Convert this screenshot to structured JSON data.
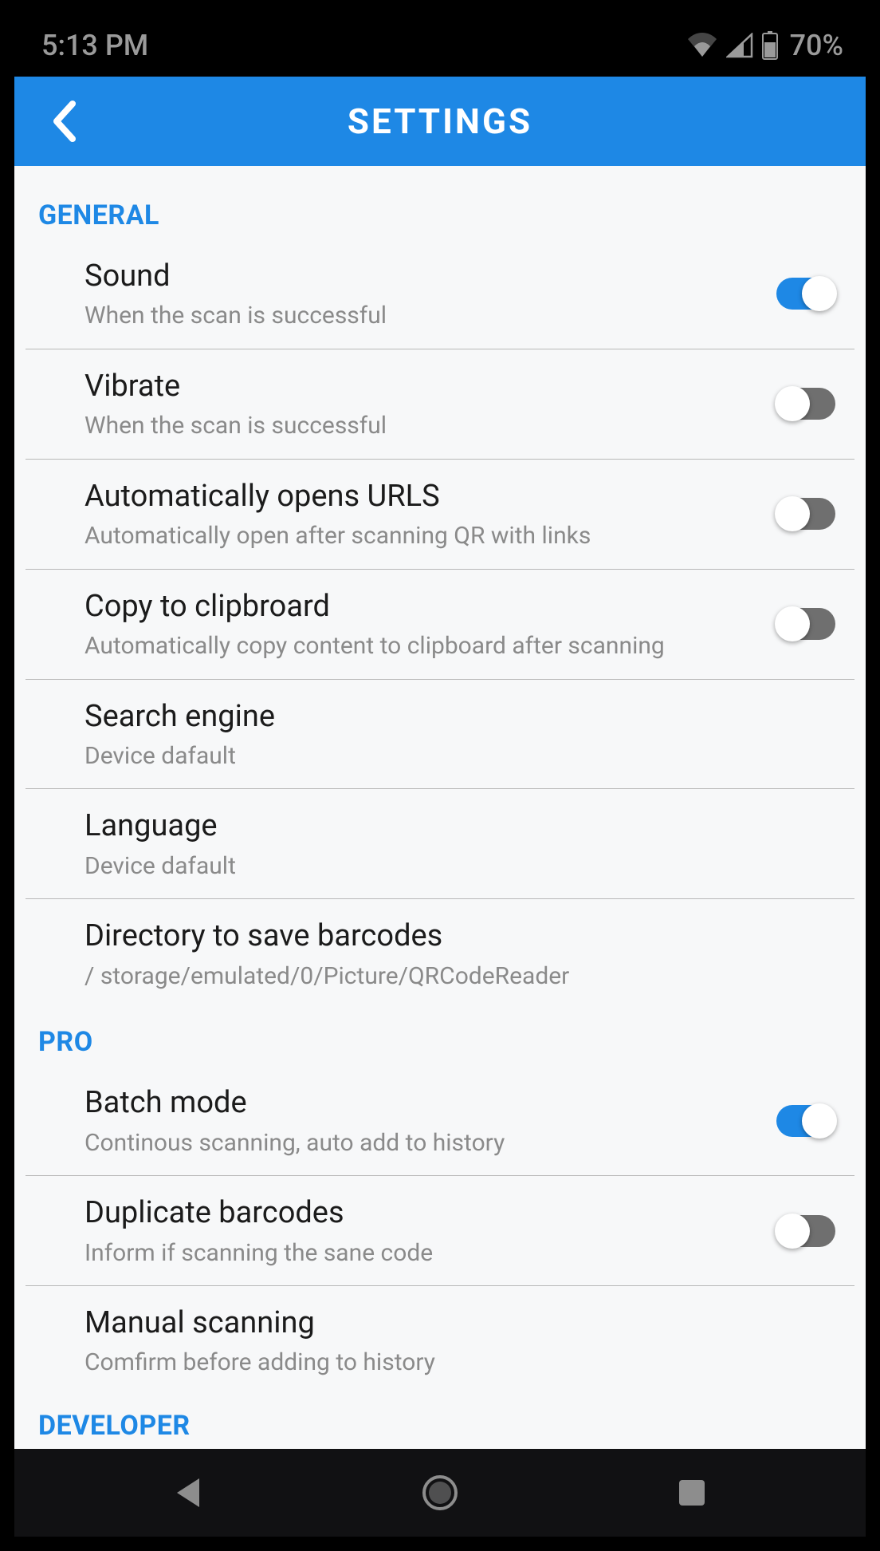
{
  "status": {
    "time": "5:13 PM",
    "battery": "70%"
  },
  "header": {
    "title": "SETTINGS"
  },
  "sections": {
    "general": {
      "label": "GENERAL",
      "sound": {
        "title": "Sound",
        "sub": "When the scan is successful",
        "on": true
      },
      "vibrate": {
        "title": "Vibrate",
        "sub": "When the scan is successful",
        "on": false
      },
      "auto_urls": {
        "title": "Automatically opens URLS",
        "sub": "Automatically open after scanning QR with links",
        "on": false
      },
      "clipboard": {
        "title": "Copy to clipbroard",
        "sub": "Automatically copy content  to clipboard after scanning",
        "on": false
      },
      "search_engine": {
        "title": "Search engine",
        "sub": "Device dafault"
      },
      "language": {
        "title": "Language",
        "sub": "Device dafault"
      },
      "directory": {
        "title": "Directory to save barcodes",
        "sub": "/ storage/emulated/0/Picture/QRCodeReader"
      }
    },
    "pro": {
      "label": "PRO",
      "batch": {
        "title": "Batch mode",
        "sub": "Continous scanning, auto add to history",
        "on": true
      },
      "duplicate": {
        "title": "Duplicate barcodes",
        "sub": "Inform if scanning the sane code",
        "on": false
      },
      "manual": {
        "title": "Manual scanning",
        "sub": "Comfirm before adding to history"
      }
    },
    "developer": {
      "label": "DEVELOPER"
    }
  }
}
